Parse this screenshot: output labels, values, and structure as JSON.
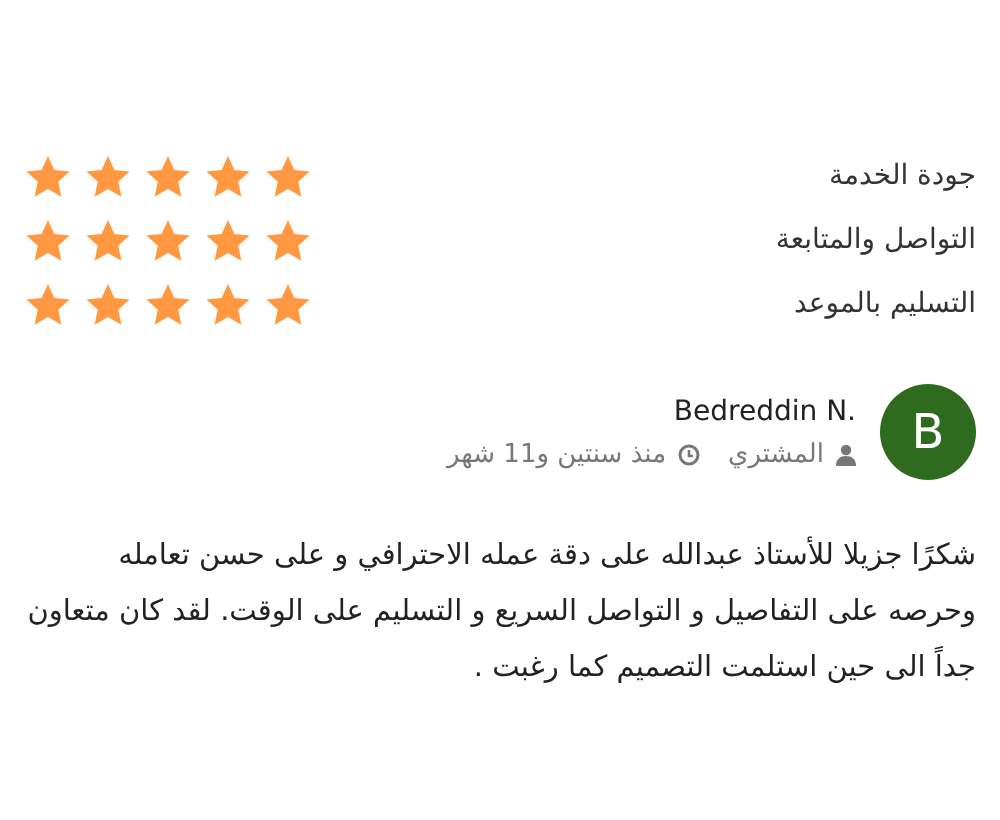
{
  "ratings": [
    {
      "label": "جودة الخدمة",
      "stars": 5
    },
    {
      "label": "التواصل والمتابعة",
      "stars": 5
    },
    {
      "label": "التسليم بالموعد",
      "stars": 5
    }
  ],
  "review": {
    "avatar_letter": "B",
    "name": "Bedreddin N.",
    "role": "المشتري",
    "time": "منذ سنتين و11 شهر",
    "comment": "شكرًا جزيلا للأستاذ عبدالله على دقة عمله الاحترافي و على حسن تعامله وحرصه على التفاصيل و التواصل السريع و التسليم على الوقت. لقد كان متعاون جداً الى حين استلمت التصميم كما رغبت ."
  }
}
